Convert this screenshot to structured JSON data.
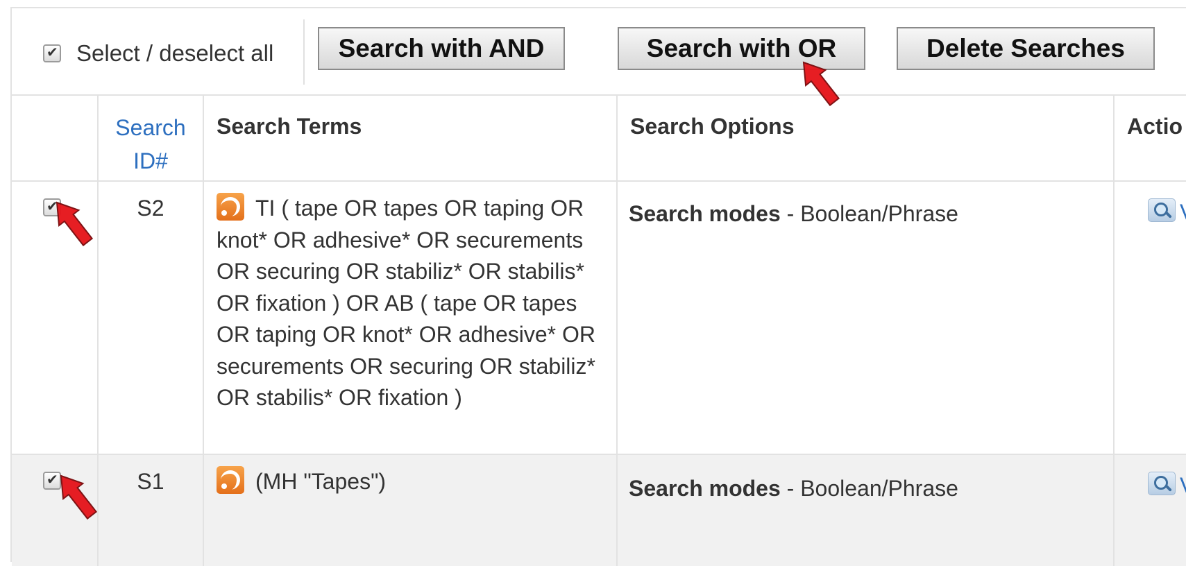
{
  "toolbar": {
    "select_all_label": "Select / deselect all",
    "search_and_label": "Search with AND",
    "search_or_label": "Search with OR",
    "delete_label": "Delete Searches"
  },
  "table": {
    "headers": {
      "search_id_line1": "Search",
      "search_id_line2": "ID#",
      "terms": "Search Terms",
      "options": "Search Options",
      "actions": "Actio"
    },
    "rows": [
      {
        "id": "S2",
        "checked": true,
        "terms": "TI ( tape OR tapes OR taping OR knot* OR adhesive* OR securements OR securing OR stabiliz* OR stabilis* OR fixation ) OR AB ( tape OR tapes OR taping OR knot* OR adhesive* OR securements OR securing OR stabiliz* OR stabilis* OR fixation )",
        "options_label": "Search modes",
        "options_value": " - Boolean/Phrase",
        "action_cut": "V"
      },
      {
        "id": "S1",
        "checked": true,
        "terms": "(MH \"Tapes\")",
        "options_label": "Search modes",
        "options_value": " - Boolean/Phrase",
        "action_cut": "V"
      }
    ]
  },
  "icons": {
    "rss": "rss-icon",
    "view": "magnifier-icon",
    "arrow": "red-arrow-pointer-icon"
  },
  "colors": {
    "link": "#2d6fbf",
    "rss": "#e4701b",
    "arrow": "#e5151b",
    "row_alt": "#f1f1f1"
  }
}
